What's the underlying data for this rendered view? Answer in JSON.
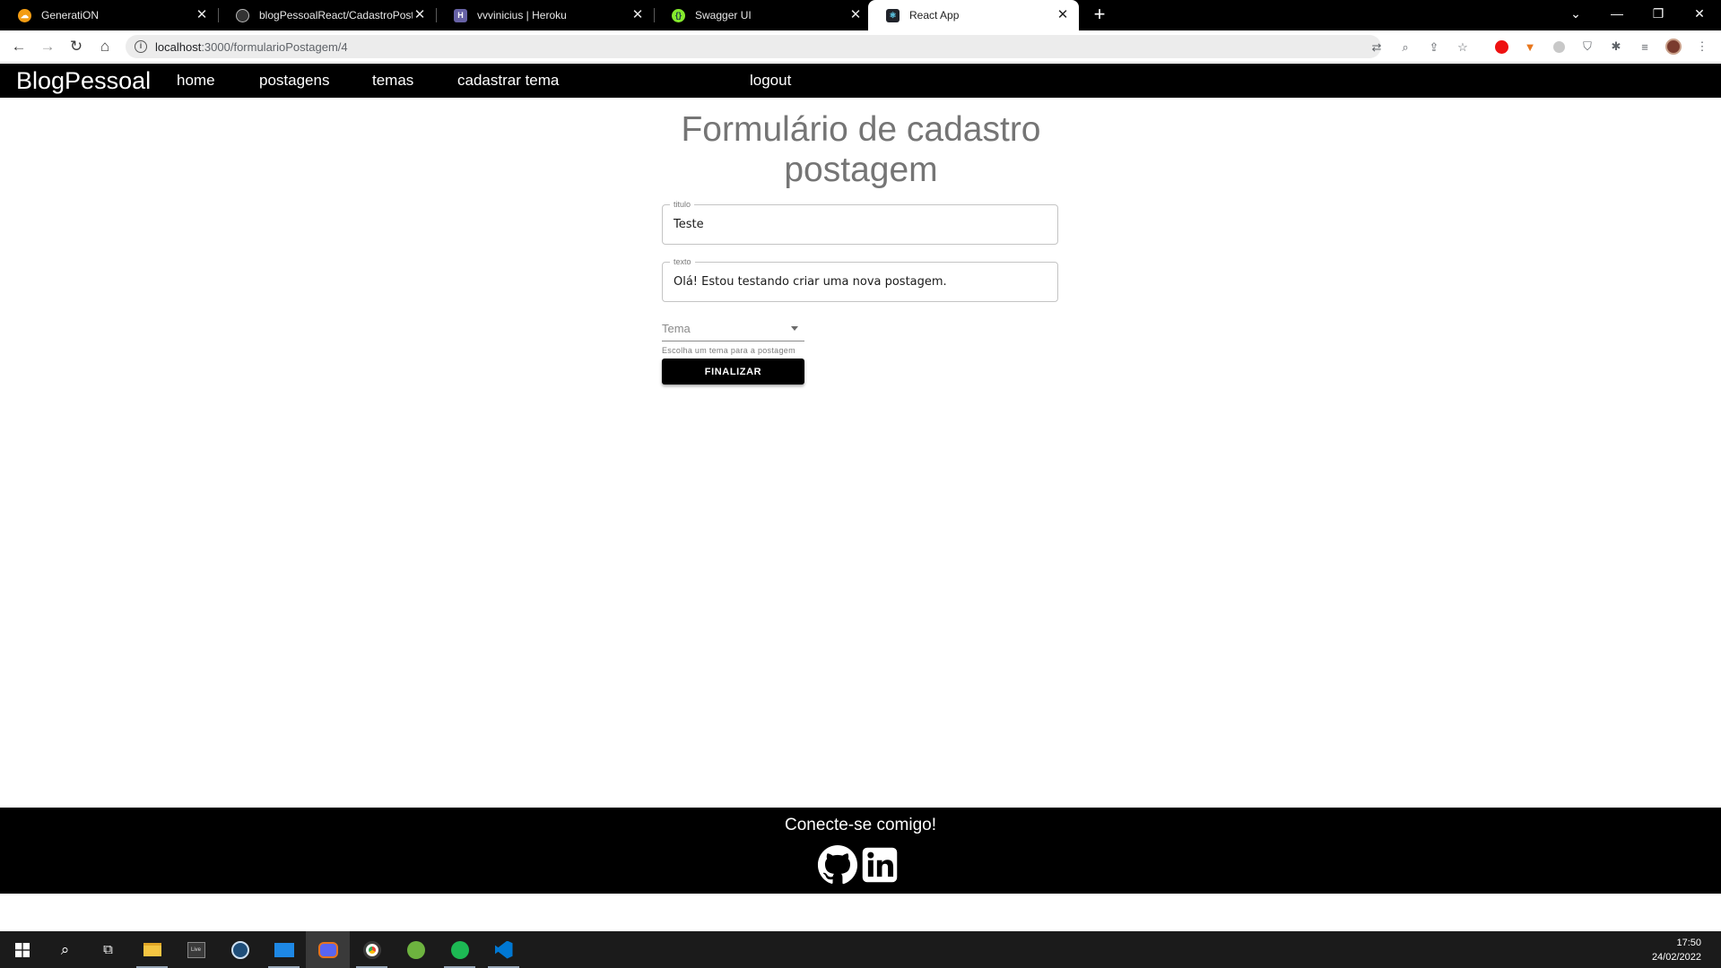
{
  "browser": {
    "tabs": [
      {
        "title": "GeneratiON",
        "icon": "cloud-icon",
        "color": "#f39c12"
      },
      {
        "title": "blogPessoalReact/CadastroPost.t",
        "icon": "github-icon",
        "color": "#333333"
      },
      {
        "title": "vvvinicius | Heroku",
        "icon": "heroku-icon",
        "color": "#6762a6"
      },
      {
        "title": "Swagger UI",
        "icon": "swagger-icon",
        "color": "#85ea2d"
      },
      {
        "title": "React App",
        "icon": "react-icon",
        "color": "#61dafb"
      }
    ],
    "url_host": "localhost",
    "url_path": ":3000/formularioPostagem/4"
  },
  "app": {
    "brand": "BlogPessoal",
    "nav": {
      "home": "home",
      "postagens": "postagens",
      "temas": "temas",
      "cadastrar_tema": "cadastrar tema",
      "logout": "logout"
    }
  },
  "form": {
    "title_line1": "Formulário de cadastro",
    "title_line2": "postagem",
    "titulo_label": "titulo",
    "titulo_value": "Teste",
    "texto_label": "texto",
    "texto_value": "Olá! Estou testando criar uma nova postagem.",
    "tema_placeholder": "Tema",
    "tema_helper": "Escolha um tema para a postagem",
    "submit_label": "FINALIZAR"
  },
  "footer": {
    "title": "Conecte-se comigo!"
  },
  "taskbar": {
    "time": "17:50",
    "date": "24/02/2022"
  }
}
